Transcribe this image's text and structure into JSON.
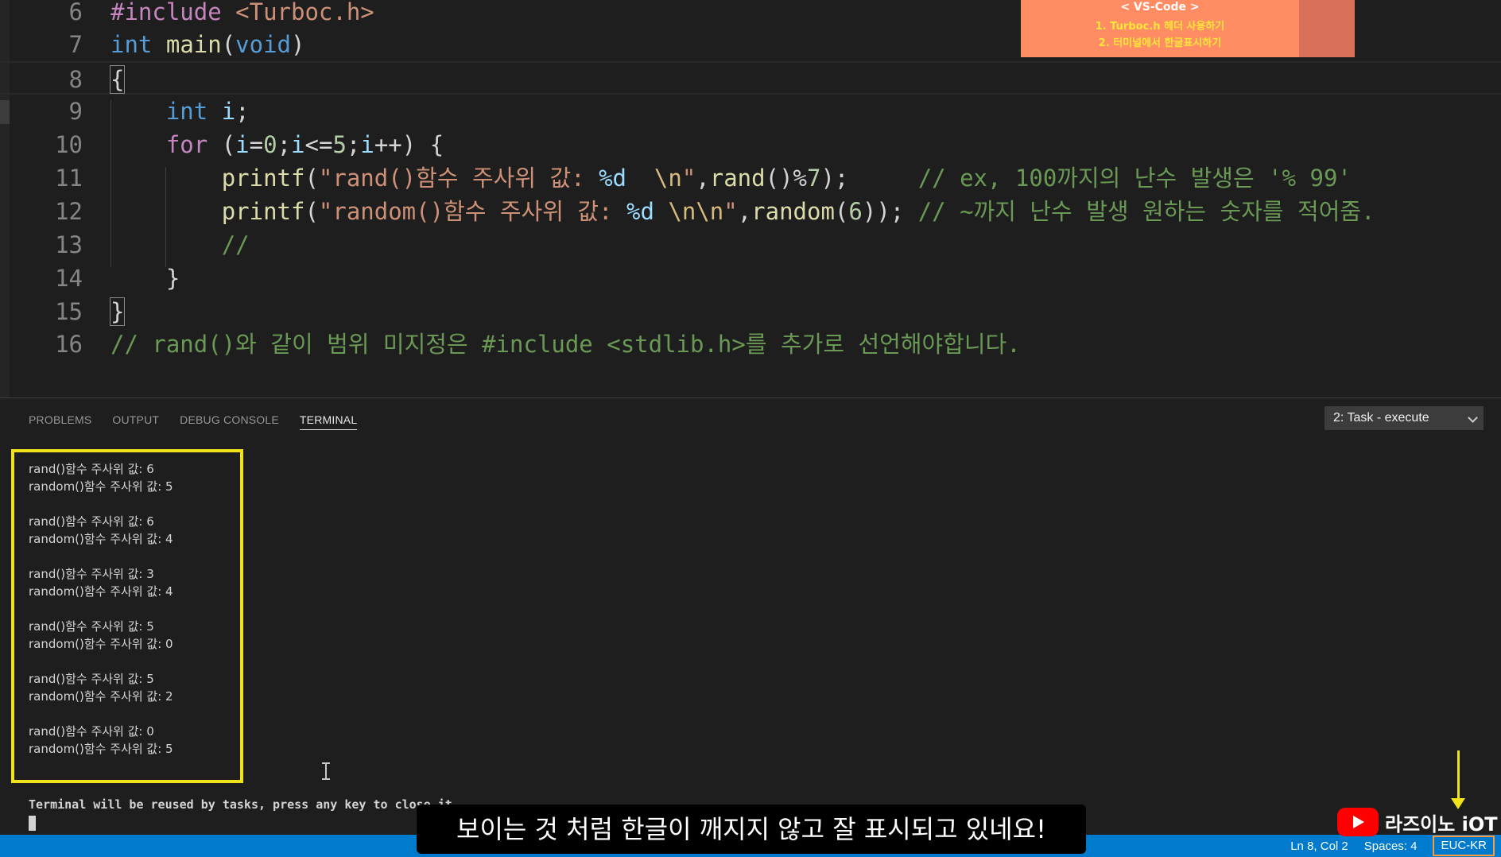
{
  "editor": {
    "line_numbers": [
      "6",
      "7",
      "8",
      "9",
      "10",
      "11",
      "12",
      "13",
      "14",
      "15",
      "16"
    ],
    "line6": {
      "directive": "#include",
      "header": "<Turboc.h>"
    },
    "line7": {
      "type": "int",
      "name": "main",
      "open": "(",
      "param": "void",
      "close": ")"
    },
    "line8": {
      "brace": "{"
    },
    "line9": {
      "type": "int",
      "var": "i",
      "semi": ";"
    },
    "line10": {
      "kw": "for",
      "p1": "(",
      "v1": "i",
      "eq": "=",
      "n0": "0",
      "s1": ";",
      "v2": "i",
      "le": "<=",
      "n5": "5",
      "s2": ";",
      "v3": "i",
      "inc": "++",
      "p2": ")",
      "brace": "{"
    },
    "line11": {
      "fn": "printf",
      "open": "(",
      "str_a": "\"rand()함수 주사위 값: ",
      "fmt": "%d",
      "str_b": "  ",
      "esc": "\\n",
      "str_c": "\"",
      "comma": ",",
      "fn2": "rand",
      "parens": "()",
      "mod": "%",
      "num": "7",
      "close": ");",
      "comment": "// ex, 100까지의 난수 발생은 '% 99'"
    },
    "line12": {
      "fn": "printf",
      "open": "(",
      "str_a": "\"random()함수 주사위 값: ",
      "fmt": "%d",
      "str_b": " ",
      "esc": "\\n\\n",
      "str_c": "\"",
      "comma": ",",
      "fn2": "random",
      "p1": "(",
      "num": "6",
      "close": "));",
      "comment": "// ~까지 난수 발생 원하는 숫자를 적어줌."
    },
    "line13": {
      "comment": "//"
    },
    "line14": {
      "brace": "}"
    },
    "line15": {
      "brace": "}"
    },
    "line16": {
      "comment": "// rand()와 같이 범위 미지정은 #include <stdlib.h>를 추가로 선언해야합니다."
    }
  },
  "overlay_note": {
    "title": "< VS-Code >",
    "line1": "1. Turboc.h 헤더 사용하기",
    "line2": "2. 터미널에서 한글표시하기"
  },
  "panel": {
    "tabs": [
      "PROBLEMS",
      "OUTPUT",
      "DEBUG CONSOLE",
      "TERMINAL"
    ],
    "active_tab": "TERMINAL",
    "task_select": "2: Task - execute"
  },
  "terminal": {
    "output": [
      [
        "rand()함수 주사위 값: 6",
        "random()함수 주사위 값: 5"
      ],
      [
        "rand()함수 주사위 값: 6",
        "random()함수 주사위 값: 4"
      ],
      [
        "rand()함수 주사위 값: 3",
        "random()함수 주사위 값: 4"
      ],
      [
        "rand()함수 주사위 값: 5",
        "random()함수 주사위 값: 0"
      ],
      [
        "rand()함수 주사위 값: 5",
        "random()함수 주사위 값: 2"
      ],
      [
        "rand()함수 주사위 값: 0",
        "random()함수 주사위 값: 5"
      ]
    ],
    "reuse_message": "Terminal will be reused by tasks, press any key to close it."
  },
  "subtitle": "보이는 것 처럼 한글이 깨지지 않고 잘 표시되고 있네요!",
  "logo": {
    "icon": "youtube-play-icon",
    "text": "라즈이노 iOT"
  },
  "statusbar": {
    "position": "Ln 8, Col 2",
    "spaces": "Spaces: 4",
    "encoding": "EUC-KR"
  },
  "colors": {
    "keyword": "#569cd6",
    "preprocessor": "#c586c0",
    "function": "#dcdcaa",
    "string": "#ce9178",
    "comment": "#6a9955",
    "number": "#b5cea8",
    "highlight": "#f2e21b",
    "statusbar": "#007acc",
    "note_bg": "#ff8c62"
  }
}
